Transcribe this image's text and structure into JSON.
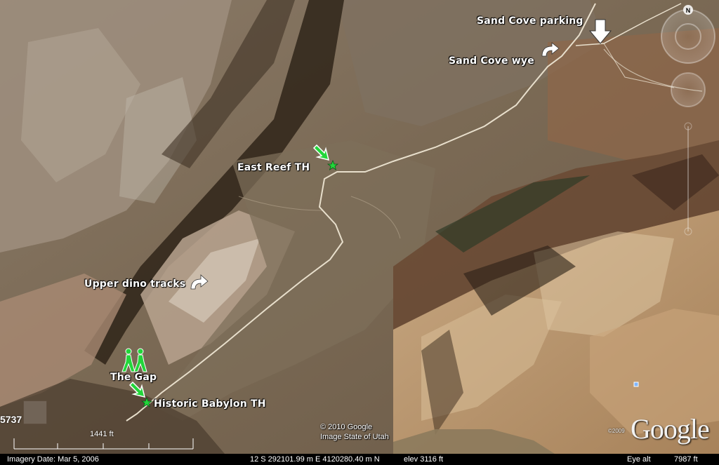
{
  "labels": {
    "sand_cove_parking": "Sand Cove parking",
    "sand_cove_wye": "Sand Cove wye",
    "east_reef_th": "East Reef TH",
    "upper_dino_tracks": "Upper dino tracks",
    "the_gap": "The Gap",
    "historic_babylon_th": "Historic Babylon TH"
  },
  "compass_letter": "N",
  "left_number": "5737",
  "scale_label": "1441 ft",
  "copyright": {
    "line1": "© 2010 Google",
    "line2": "Image State of Utah"
  },
  "logo": {
    "year": "©2009",
    "text": "Google"
  },
  "status": {
    "imagery_date": "Imagery Date: Mar  5, 2006",
    "coords": "12 S  292101.99 m E  4120280.40 m N",
    "elev": "elev  3116 ft",
    "eye_alt_label": "Eye alt",
    "eye_alt_value": "7987 ft"
  },
  "icons": {
    "parking_marker": "down-arrow-icon",
    "wye_marker": "curved-arrow-icon",
    "trailhead_marker": "green-star-icon",
    "hiker_marker": "hikers-icon",
    "pointer_marker": "green-arrow-icon"
  },
  "colors": {
    "trail": "#e8dfcc",
    "marker_green": "#22d63a",
    "status_bg": "#000000"
  }
}
